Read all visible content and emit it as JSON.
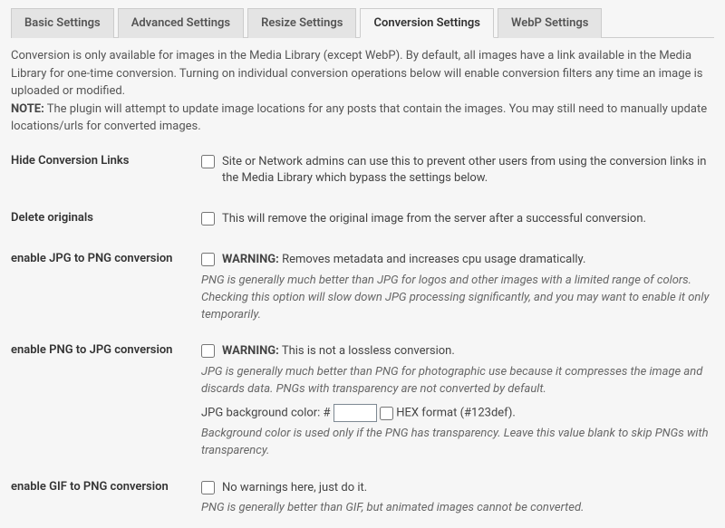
{
  "tabs": {
    "basic": "Basic Settings",
    "advanced": "Advanced Settings",
    "resize": "Resize Settings",
    "conversion": "Conversion Settings",
    "webp": "WebP Settings"
  },
  "intro": {
    "line1": "Conversion is only available for images in the Media Library (except WebP). By default, all images have a link available in the Media Library for one-time conversion. Turning on individual conversion operations below will enable conversion filters any time an image is uploaded or modified.",
    "note_label": "NOTE:",
    "note_text": " The plugin will attempt to update image locations for any posts that contain the images. You may still need to manually update locations/urls for converted images."
  },
  "hide_links": {
    "label": "Hide Conversion Links",
    "desc": "Site or Network admins can use this to prevent other users from using the conversion links in the Media Library which bypass the settings below."
  },
  "delete_originals": {
    "label": "Delete originals",
    "desc": "This will remove the original image from the server after a successful conversion."
  },
  "jpg2png": {
    "label": "enable JPG to PNG conversion",
    "warn_label": "WARNING:",
    "warn_text": " Removes metadata and increases cpu usage dramatically.",
    "note": "PNG is generally much better than JPG for logos and other images with a limited range of colors. Checking this option will slow down JPG processing significantly, and you may want to enable it only temporarily."
  },
  "png2jpg": {
    "label": "enable PNG to JPG conversion",
    "warn_label": "WARNING:",
    "warn_text": " This is not a lossless conversion.",
    "note": "JPG is generally much better than PNG for photographic use because it compresses the image and discards data. PNGs with transparency are not converted by default.",
    "bg_label": "JPG background color: #",
    "bg_value": "",
    "hex_label": " HEX format (#123def).",
    "bg_note": "Background color is used only if the PNG has transparency. Leave this value blank to skip PNGs with transparency."
  },
  "gif2png": {
    "label": "enable GIF to PNG conversion",
    "desc": "No warnings here, just do it.",
    "note": "PNG is generally better than GIF, but animated images cannot be converted."
  }
}
